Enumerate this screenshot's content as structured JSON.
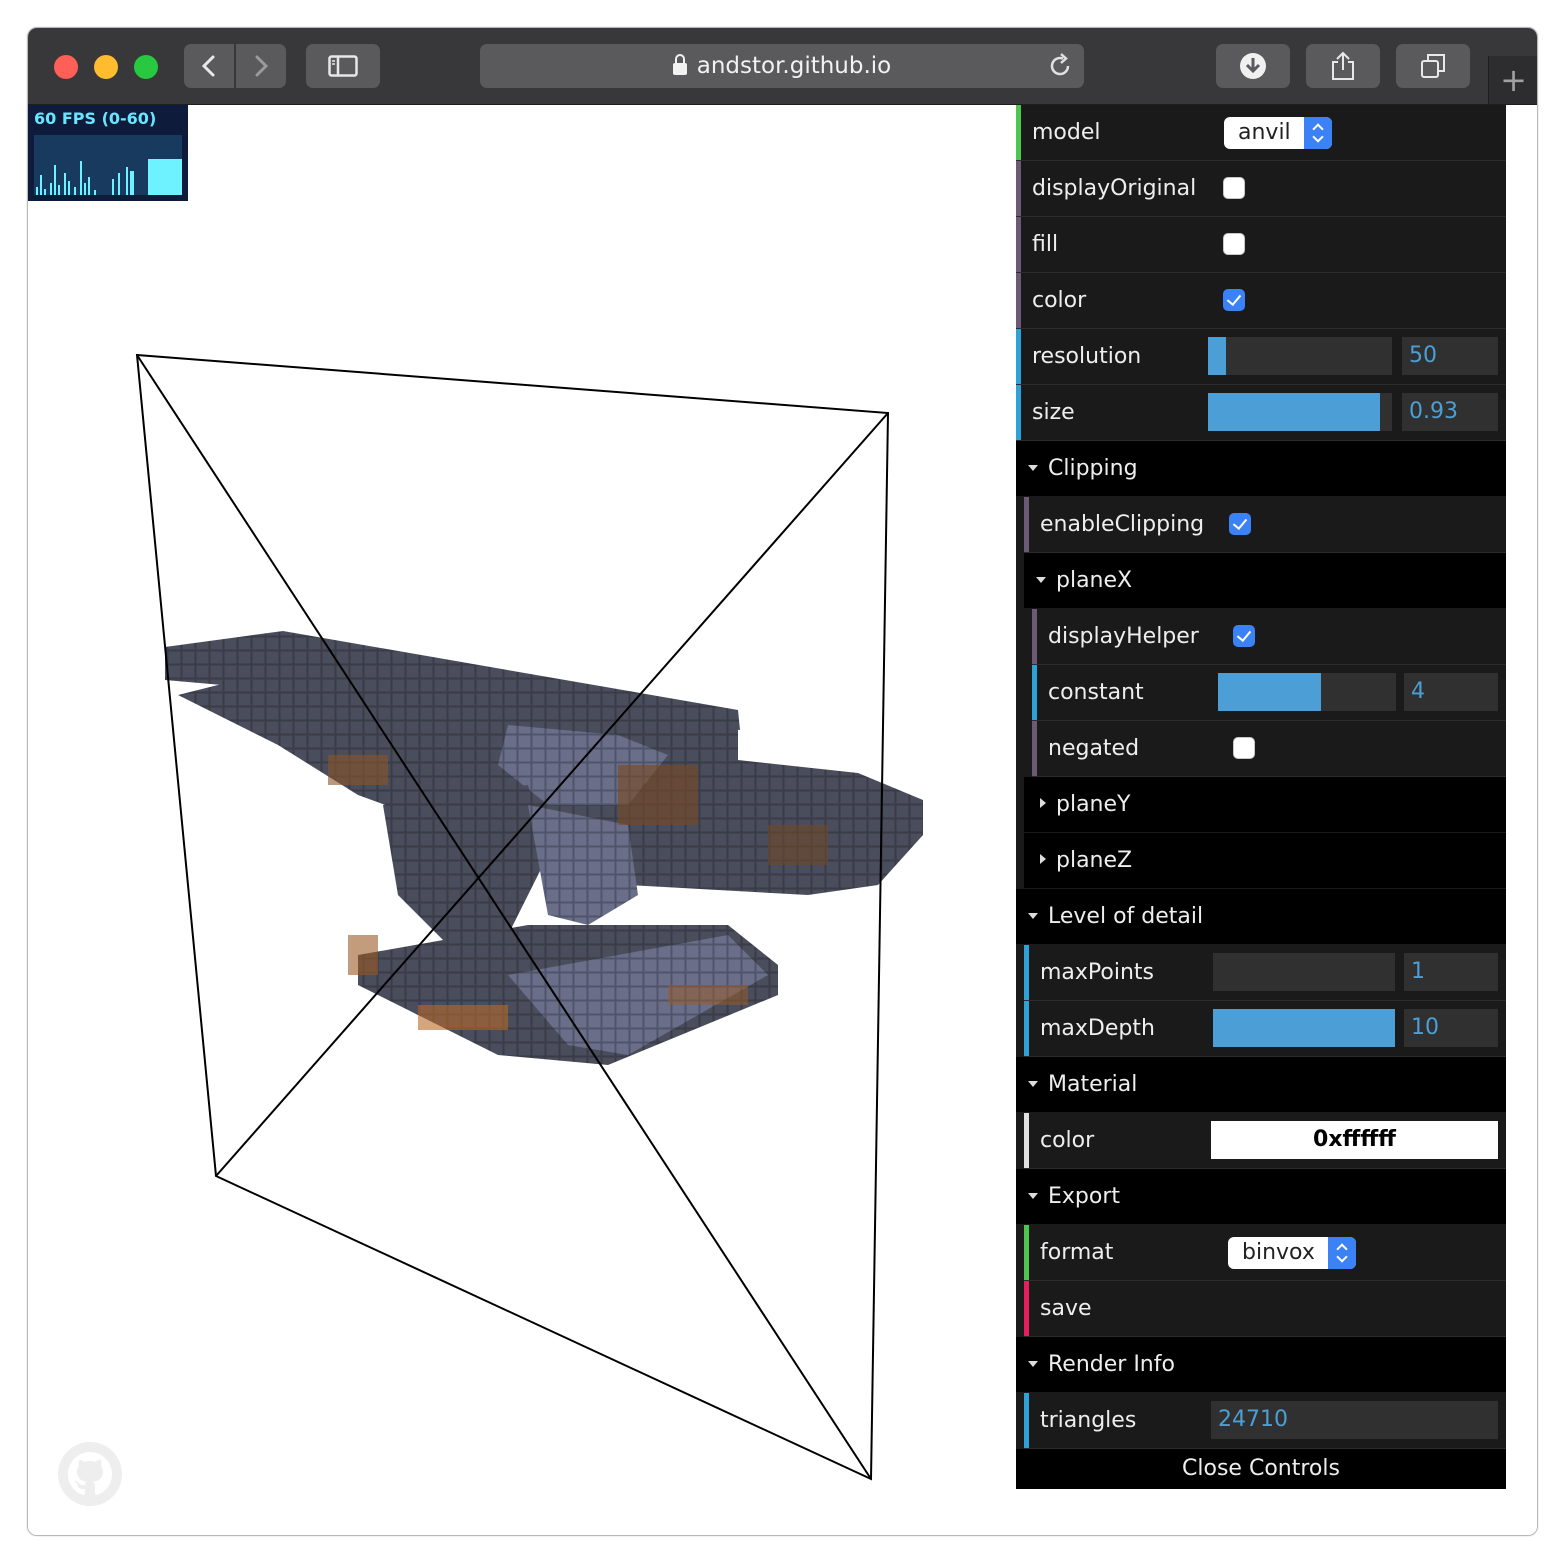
{
  "browser": {
    "url": "andstor.github.io",
    "new_tab": "+"
  },
  "stats": {
    "fps_label": "60 FPS (0-60)"
  },
  "gui": {
    "model": {
      "label": "model",
      "value": "anvil"
    },
    "displayOriginal": {
      "label": "displayOriginal",
      "checked": false
    },
    "fill": {
      "label": "fill",
      "checked": false
    },
    "color": {
      "label": "color",
      "checked": true
    },
    "resolution": {
      "label": "resolution",
      "value": "50",
      "fraction": 0.1
    },
    "size": {
      "label": "size",
      "value": "0.93",
      "fraction": 0.93
    },
    "clipping": {
      "title": "Clipping",
      "enableClipping": {
        "label": "enableClipping",
        "checked": true
      },
      "planeX": {
        "title": "planeX",
        "displayHelper": {
          "label": "displayHelper",
          "checked": true
        },
        "constant": {
          "label": "constant",
          "value": "4",
          "fraction": 0.58
        },
        "negated": {
          "label": "negated",
          "checked": false
        }
      },
      "planeY": {
        "title": "planeY"
      },
      "planeZ": {
        "title": "planeZ"
      }
    },
    "lod": {
      "title": "Level of detail",
      "maxPoints": {
        "label": "maxPoints",
        "value": "1",
        "fraction": 0.0
      },
      "maxDepth": {
        "label": "maxDepth",
        "value": "10",
        "fraction": 1.0
      }
    },
    "material": {
      "title": "Material",
      "color": {
        "label": "color",
        "value": "0xffffff"
      }
    },
    "export": {
      "title": "Export",
      "format": {
        "label": "format",
        "value": "binvox"
      },
      "save": {
        "label": "save"
      }
    },
    "renderInfo": {
      "title": "Render Info",
      "triangles": {
        "label": "triangles",
        "value": "24710"
      }
    },
    "close_label": "Close Controls"
  },
  "colors": {
    "toolbar": "#38383a",
    "accent_blue": "#4c9fd6",
    "checkbox_blue": "#3b82f6",
    "panel_bg": "#1a1a1a",
    "fps_cyan": "#6ef2ff"
  },
  "icons": [
    "back-icon",
    "forward-icon",
    "sidebar-icon",
    "lock-icon",
    "reload-icon",
    "download-icon",
    "share-icon",
    "tabs-icon",
    "github-icon"
  ]
}
